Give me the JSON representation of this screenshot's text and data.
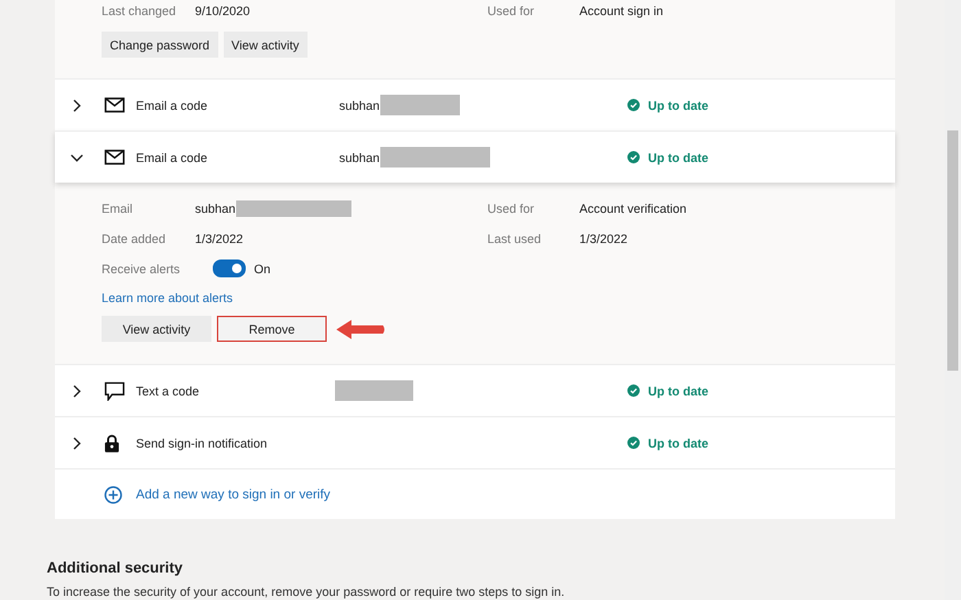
{
  "password_details": {
    "fields": [
      {
        "label": "Last changed",
        "value": "9/10/2020"
      },
      {
        "label": "Used for",
        "value": "Account sign in"
      }
    ],
    "buttons": [
      "Change password",
      "View activity"
    ]
  },
  "methods": [
    {
      "kind": "email",
      "name": "Email a code",
      "value": "subhan",
      "redacted": true,
      "status": "Up to date",
      "expanded": false
    },
    {
      "kind": "email",
      "name": "Email a code",
      "value": "subhan",
      "redacted": true,
      "status": "Up to date",
      "expanded": true,
      "details": {
        "fields": [
          {
            "label": "Email",
            "value": "subhan",
            "redacted": true
          },
          {
            "label": "Used for",
            "value": "Account verification"
          },
          {
            "label": "Date added",
            "value": "1/3/2022"
          },
          {
            "label": "Last used",
            "value": "1/3/2022"
          }
        ],
        "toggle": {
          "label": "Receive alerts",
          "on": true,
          "state_text": "On"
        },
        "link": "Learn more about alerts",
        "buttons": [
          {
            "label": "View activity",
            "highlighted": false
          },
          {
            "label": "Remove",
            "highlighted": true
          }
        ]
      }
    },
    {
      "kind": "text",
      "name": "Text a code",
      "redacted": true,
      "status": "Up to date",
      "expanded": false
    },
    {
      "kind": "notification",
      "name": "Send sign-in notification",
      "status": "Up to date",
      "expanded": false
    }
  ],
  "add_link": "Add a new way to sign in or verify",
  "additional_security": {
    "title": "Additional security",
    "description": "To increase the security of your account, remove your password or require two steps to sign in."
  }
}
